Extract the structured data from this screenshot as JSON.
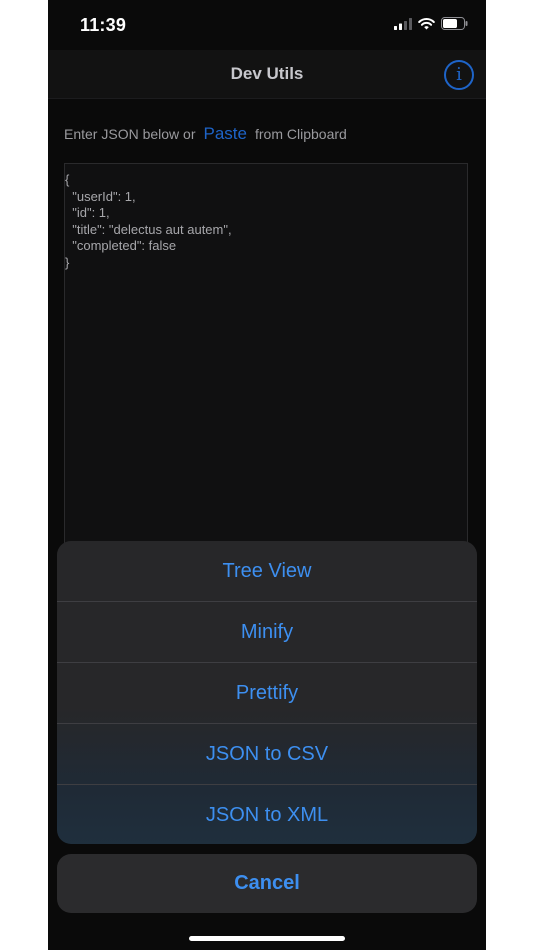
{
  "status_bar": {
    "time": "11:39",
    "icons": [
      "signal-icon",
      "wifi-icon",
      "battery-icon"
    ],
    "battery_level": 0.7
  },
  "nav": {
    "title": "Dev Utils",
    "info_icon": "info-icon"
  },
  "prompt": {
    "before": "Enter JSON below or",
    "paste_label": "Paste",
    "after": "from Clipboard"
  },
  "editor": {
    "value": "{\n  \"userId\": 1,\n  \"id\": 1,\n  \"title\": \"delectus aut autem\",\n  \"completed\": false\n}"
  },
  "action_sheet": {
    "items": [
      {
        "label": "Tree View"
      },
      {
        "label": "Minify"
      },
      {
        "label": "Prettify"
      },
      {
        "label": "JSON to CSV"
      },
      {
        "label": "JSON to XML"
      }
    ],
    "cancel_label": "Cancel"
  },
  "colors": {
    "accent": "#3d8ff0",
    "link": "#1e64c8",
    "background": "#0a0a0a",
    "sheet": "#272729"
  }
}
